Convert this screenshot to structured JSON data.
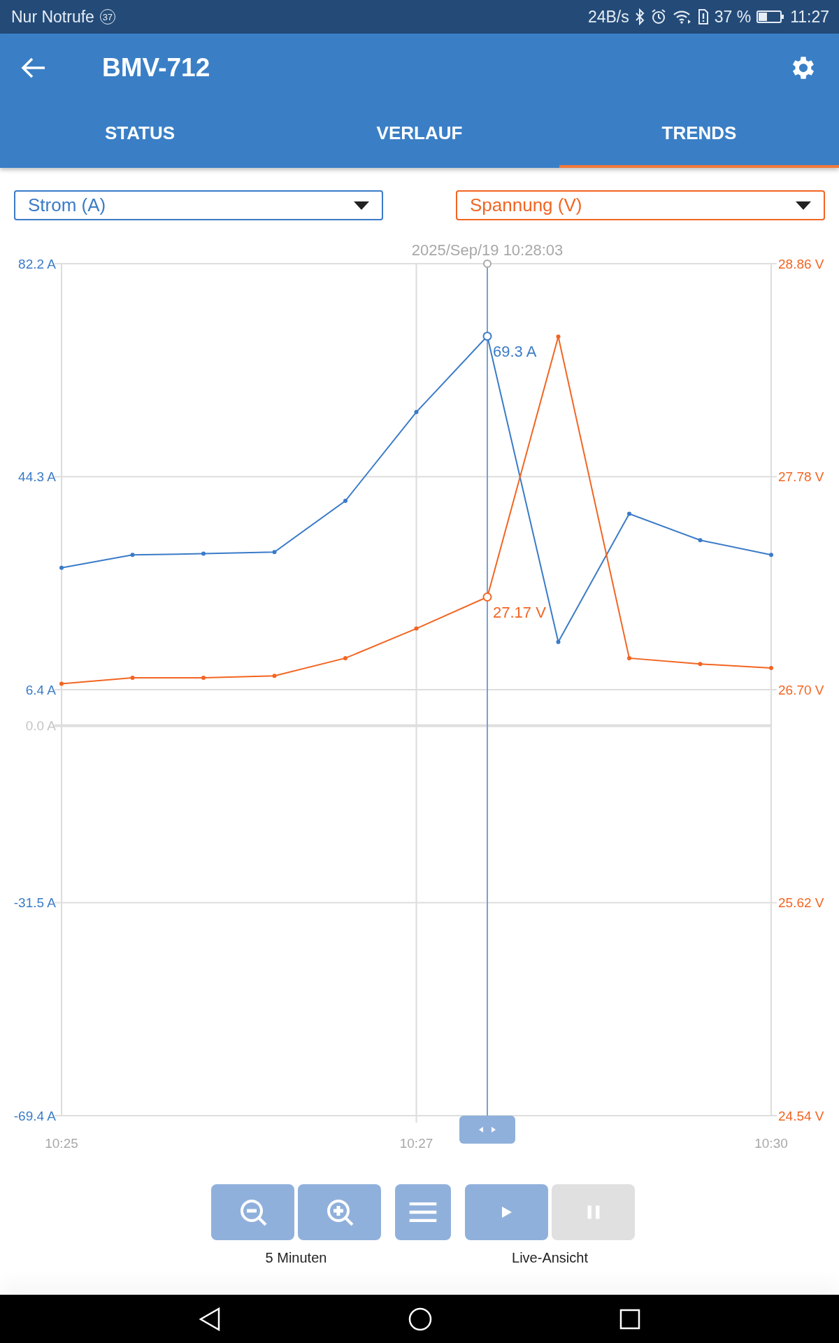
{
  "status_bar": {
    "carrier": "Nur Notrufe",
    "notification_count": "37",
    "speed": "24B/s",
    "battery": "37 %",
    "time": "11:27"
  },
  "app_bar": {
    "title": "BMV-712"
  },
  "tabs": [
    {
      "label": "STATUS",
      "selected": false
    },
    {
      "label": "VERLAUF",
      "selected": false
    },
    {
      "label": "TRENDS",
      "selected": true
    }
  ],
  "selectors": [
    {
      "label": "Strom (A)",
      "color": "#3a7bc8"
    },
    {
      "label": "Spannung (V)",
      "color": "#f26522"
    }
  ],
  "chart": {
    "cursor": {
      "timestamp": "2025/Sep/19 10:28:03"
    },
    "chart_data": {
      "type": "line",
      "grid": true,
      "categories": [
        "10:25",
        null,
        null,
        null,
        null,
        "10:27",
        null,
        null,
        null,
        null,
        "10:30"
      ],
      "ylim": [
        -69.4,
        82.2
      ],
      "yticks": [
        {
          "value": 82.2,
          "label": "82.2 A"
        },
        {
          "value": 44.3,
          "label": "44.3 A"
        },
        {
          "value": 6.4,
          "label": "6.4 A"
        },
        {
          "value": 0,
          "label": "0.0 A"
        },
        {
          "value": -31.5,
          "label": "-31.5 A"
        },
        {
          "value": -69.4,
          "label": "-69.4 A"
        }
      ],
      "y2lim": [
        24.54,
        28.86
      ],
      "y2ticks": [
        {
          "value": 28.86,
          "label": "28.86 V"
        },
        {
          "value": 27.78,
          "label": "27.78 V"
        },
        {
          "value": 26.7,
          "label": "26.70 V"
        },
        {
          "value": 25.62,
          "label": "25.62 V"
        },
        {
          "value": 24.54,
          "label": "24.54 V"
        }
      ],
      "series": [
        {
          "color": "#3a7bc8",
          "marker": "circle",
          "values": [
            28.1,
            30.4,
            30.6,
            30.9,
            40.0,
            55.8,
            69.3,
            14.9,
            37.7,
            33.0,
            30.4
          ]
        },
        {
          "color": "#f26522",
          "axis": "y2",
          "marker": "circle",
          "values": [
            26.73,
            26.76,
            26.76,
            26.77,
            26.86,
            27.01,
            27.17,
            28.49,
            26.86,
            26.83,
            26.81
          ]
        }
      ],
      "annotations": [
        "69.3 A",
        "27.17 V"
      ]
    }
  },
  "controls": {
    "buttons": [
      {
        "kind": "zoom-out"
      },
      {
        "kind": "zoom-in"
      },
      {
        "kind": "menu"
      },
      {
        "kind": "play",
        "selected": true
      },
      {
        "kind": "pause",
        "selected": false
      }
    ],
    "zoom_label": "5 Minuten",
    "live_label": "Live-Ansicht"
  }
}
